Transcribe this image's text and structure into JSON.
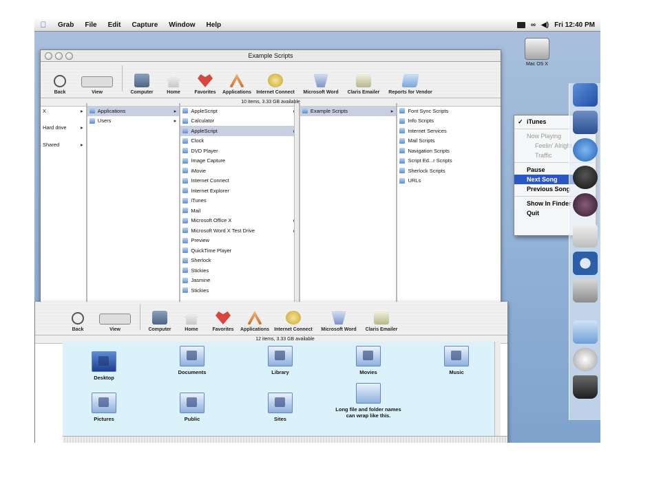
{
  "menubar": {
    "items": [
      "Grab",
      "File",
      "Edit",
      "Capture",
      "Window",
      "Help"
    ],
    "clock": "Fri 12:40 PM"
  },
  "desktop": {
    "disk_label": "Mac OS X"
  },
  "window1": {
    "title": "Example Scripts",
    "toolbar": [
      "Back",
      "View",
      "Computer",
      "Home",
      "Favorites",
      "Applications",
      "Internet Connect",
      "Microsoft Word",
      "Claris Emailer",
      "Reports for Vendor"
    ],
    "status": "10 items, 3.33 GB available",
    "col0": [
      "X",
      "Hard drive",
      "Shared"
    ],
    "col1": [
      "Applications",
      "Users"
    ],
    "col2": [
      "AppleScript",
      "Calculator",
      "AppleScript",
      "Clock",
      "DVD Player",
      "Image Capture",
      "iMovie",
      "Internet Connect",
      "Internet Explorer",
      "iTunes",
      "Mail",
      "Microsoft Office X",
      "Microsoft Word X Test Drive",
      "Preview",
      "QuickTime Player",
      "Sherlock",
      "Stickies",
      "Jasmine",
      "Stickies"
    ],
    "col3": [
      "Example Scripts"
    ],
    "col4": [
      "Font Sync Scripts",
      "Info Scripts",
      "Internet Services",
      "Mail Scripts",
      "Navigation Scripts",
      "Script Ed...r Scripts",
      "Sherlock Scripts",
      "URLs"
    ]
  },
  "popup": {
    "header": "iTunes",
    "now_playing_label": "Now Playing",
    "song": "Feelin' Alright",
    "artist": "Traffic",
    "items": [
      "Pause",
      "Next Song",
      "Previous Song",
      "Show In Finder",
      "Quit"
    ],
    "highlighted": "Next Song"
  },
  "window2": {
    "toolbar": [
      "Back",
      "View",
      "Computer",
      "Home",
      "Favorites",
      "Applications",
      "Internet Connect",
      "Microsoft Word",
      "Claris Emailer"
    ],
    "status": "12 items, 3.33 GB available",
    "icons": [
      "Desktop",
      "Documents",
      "Library",
      "Movies",
      "Music",
      "Pictures",
      "Public",
      "Sites",
      "Long file and folder names can wrap like this."
    ]
  },
  "colors": {
    "highlight": "#2a56c6",
    "icon_view_bg": "#dcf2fb",
    "desktop": "#8fb0d6"
  }
}
